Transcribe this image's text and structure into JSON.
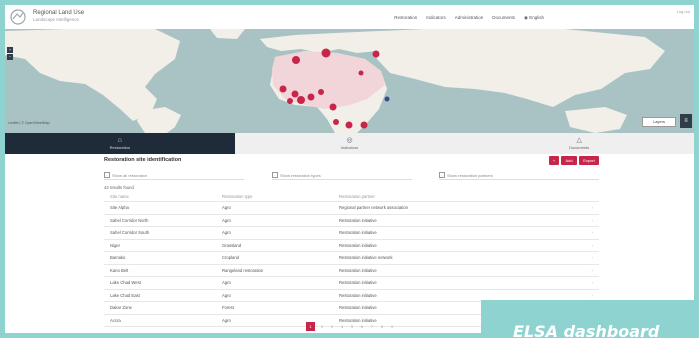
{
  "header": {
    "brand_title": "Regional Land Use",
    "brand_subtitle": "Landscape Intelligence",
    "nav": [
      "Restoration",
      "Indicators",
      "Administration",
      "Documents",
      "English"
    ],
    "user": "Log out"
  },
  "map": {
    "zoom_in_label": "+",
    "zoom_out_label": "−",
    "layer_button_label": "Layers",
    "attribution": "Leaflet | © OpenStreetMap",
    "ocean_color": "#a9c3c4",
    "land_color": "#f2efe9",
    "marker_color": "#c8254a"
  },
  "tabs": [
    {
      "icon": "⌂",
      "label": "Restoration"
    },
    {
      "icon": "◎",
      "label": "Indicators"
    },
    {
      "icon": "△",
      "label": "Documents"
    }
  ],
  "list": {
    "title": "Restoration site identification",
    "buttons": [
      "+",
      "Add",
      "Export"
    ],
    "filters": [
      "Show all restoration",
      "Show restoration types",
      "Show restoration partners"
    ],
    "results_count": "42 results found",
    "columns": [
      "Site name",
      "Restoration type",
      "Restoration partner"
    ],
    "rows": [
      [
        "Site Alpha",
        "Agro",
        "Regional partner network association"
      ],
      [
        "Sahel Corridor North",
        "Agro",
        "Restoration initiative"
      ],
      [
        "Sahel Corridor South",
        "Agro",
        "Restoration initiative"
      ],
      [
        "Niger",
        "Grassland",
        "Restoration initiative"
      ],
      [
        "Bamako",
        "Cropland",
        "Restoration initiative network"
      ],
      [
        "Kano Belt",
        "Rangeland restoration",
        "Restoration initiative"
      ],
      [
        "Lake Chad West",
        "Agro",
        "Restoration initiative"
      ],
      [
        "Lake Chad East",
        "Agro",
        "Restoration initiative"
      ],
      [
        "Dakar Zone",
        "Forest",
        "Restoration initiative"
      ],
      [
        "Accra",
        "Agro",
        "Restoration initiative"
      ]
    ],
    "pages": [
      "1",
      "2",
      "3",
      "4",
      "5",
      "6",
      "7",
      "8",
      "9"
    ]
  },
  "caption": "ELSA dashboard"
}
